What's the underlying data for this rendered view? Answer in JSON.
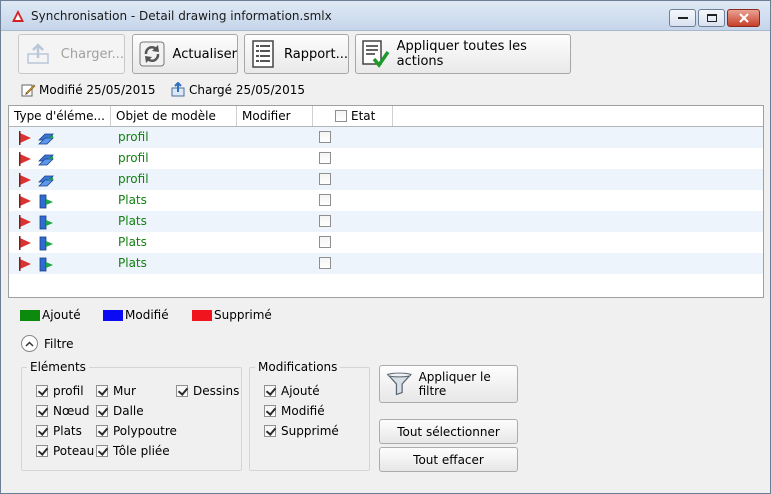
{
  "window": {
    "title": "Synchronisation - Detail drawing information.smlx"
  },
  "toolbar": {
    "load_label": "Charger...",
    "refresh_label": "Actualiser",
    "report_label": "Rapport...",
    "apply_all_label": "Appliquer toutes les actions"
  },
  "info": {
    "modified": "Modifié 25/05/2015",
    "loaded": "Chargé 25/05/2015"
  },
  "grid": {
    "columns": [
      "Type d'éléme...",
      "Objet de modèle",
      "Modifier",
      "Etat"
    ],
    "rows": [
      {
        "object": "profil",
        "kind": "profile"
      },
      {
        "object": "profil",
        "kind": "profile"
      },
      {
        "object": "profil",
        "kind": "profile"
      },
      {
        "object": "Plats",
        "kind": "plate"
      },
      {
        "object": "Plats",
        "kind": "plate"
      },
      {
        "object": "Plats",
        "kind": "plate"
      },
      {
        "object": "Plats",
        "kind": "plate"
      }
    ]
  },
  "legend": {
    "added": "Ajouté",
    "added_color": "#0d8a0d",
    "modified": "Modifié",
    "modified_color": "#0a0af5",
    "deleted": "Supprimé",
    "deleted_color": "#f0141e"
  },
  "filter": {
    "toggle_label": "Filtre",
    "elements_title": "Eléments",
    "elements": {
      "profil": "profil",
      "noeud": "Nœud",
      "plats": "Plats",
      "poteau": "Poteau",
      "mur": "Mur",
      "dalle": "Dalle",
      "polypoutre": "Polypoutre",
      "tole_pliee": "Tôle pliée",
      "dessins": "Dessins"
    },
    "modifications_title": "Modifications",
    "modifications": {
      "ajoute": "Ajouté",
      "modifie": "Modifié",
      "supprime": "Supprimé"
    },
    "apply_label": "Appliquer le filtre",
    "select_all_label": "Tout sélectionner",
    "clear_all_label": "Tout effacer"
  }
}
